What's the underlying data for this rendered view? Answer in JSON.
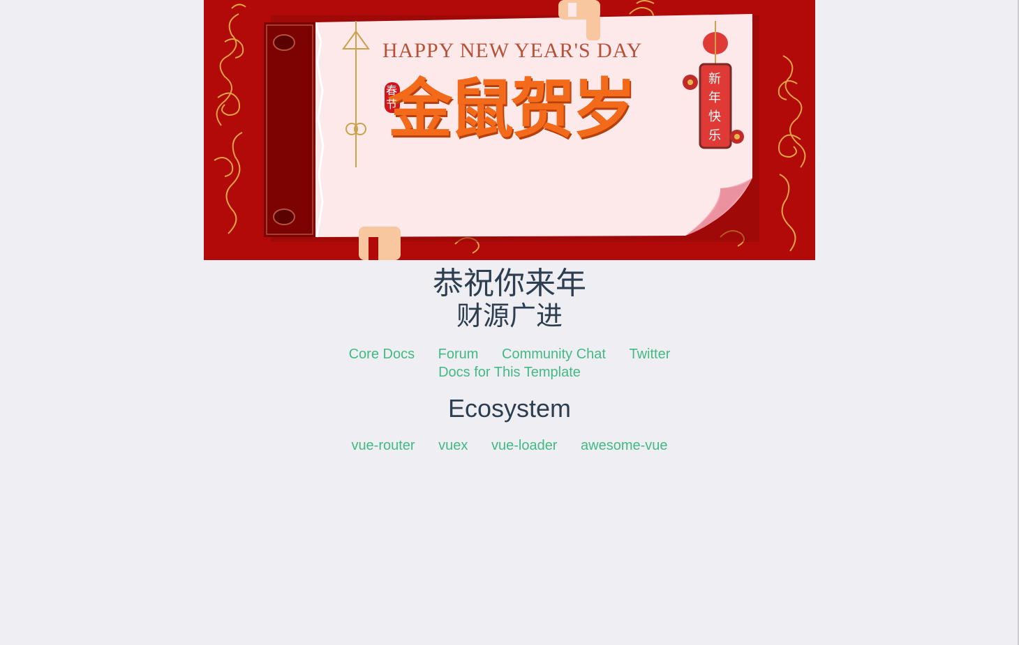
{
  "banner": {
    "headline_en": "HAPPY NEW YEAR'S DAY",
    "headline_cn": "金鼠贺岁",
    "seal_text": "春节",
    "lantern_chars": [
      "新",
      "年",
      "快",
      "乐"
    ],
    "colors": {
      "background": "#b10a08",
      "paper": "#fde8ea",
      "spine": "#7d0303",
      "headline": "#f36a1a",
      "en_text": "#b5523a",
      "gold": "#e6b64a",
      "tag": "#e03a36"
    }
  },
  "greeting": {
    "line1": "恭祝你来年",
    "line2": "财源广进"
  },
  "essential_links": [
    "Core Docs",
    "Forum",
    "Community Chat",
    "Twitter",
    "Docs for This Template"
  ],
  "ecosystem": {
    "title": "Ecosystem",
    "links": [
      "vue-router",
      "vuex",
      "vue-loader",
      "awesome-vue"
    ]
  },
  "colors": {
    "page_background": "#efeff3",
    "heading_text": "#2c3e50",
    "link": "#42b983"
  }
}
